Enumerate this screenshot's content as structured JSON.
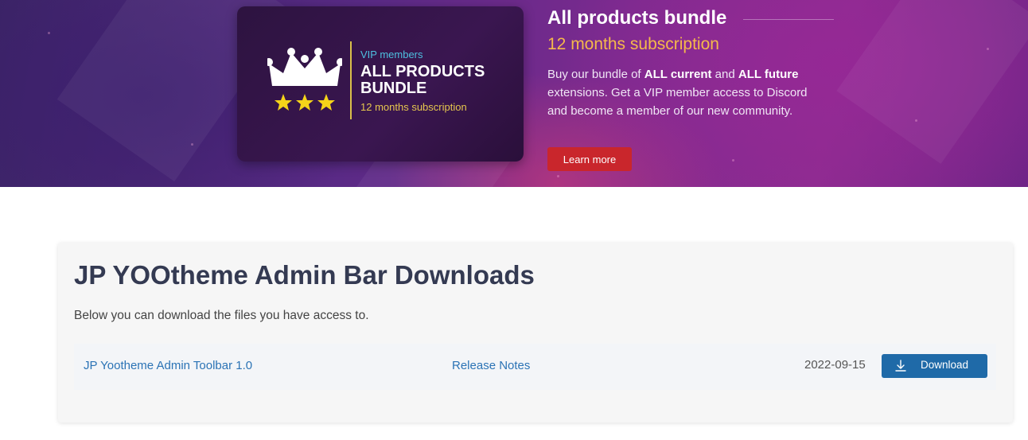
{
  "hero": {
    "card": {
      "vip_label": "VIP members",
      "title": "ALL PRODUCTS BUNDLE",
      "subtitle": "12 months subscription"
    },
    "title": "All products bundle",
    "subtitle": "12 months subscription",
    "description": {
      "part1": "Buy our bundle of ",
      "bold1": "ALL current",
      "part2": " and ",
      "bold2": "ALL future",
      "part3": " extensions. Get a VIP member access to Discord and become a member of our new community."
    },
    "learn_more_label": "Learn more"
  },
  "downloads": {
    "title": "JP YOOtheme Admin Bar Downloads",
    "intro": "Below you can download the files you have access to.",
    "files": [
      {
        "name": "JP Yootheme Admin Toolbar 1.0",
        "notes_label": "Release Notes",
        "date": "2022-09-15",
        "download_label": "Download"
      }
    ]
  },
  "colors": {
    "accent_red": "#c9262c",
    "link_blue": "#2b73b5",
    "button_blue": "#1f6aa8",
    "subtitle_gold": "#f5b94a"
  }
}
